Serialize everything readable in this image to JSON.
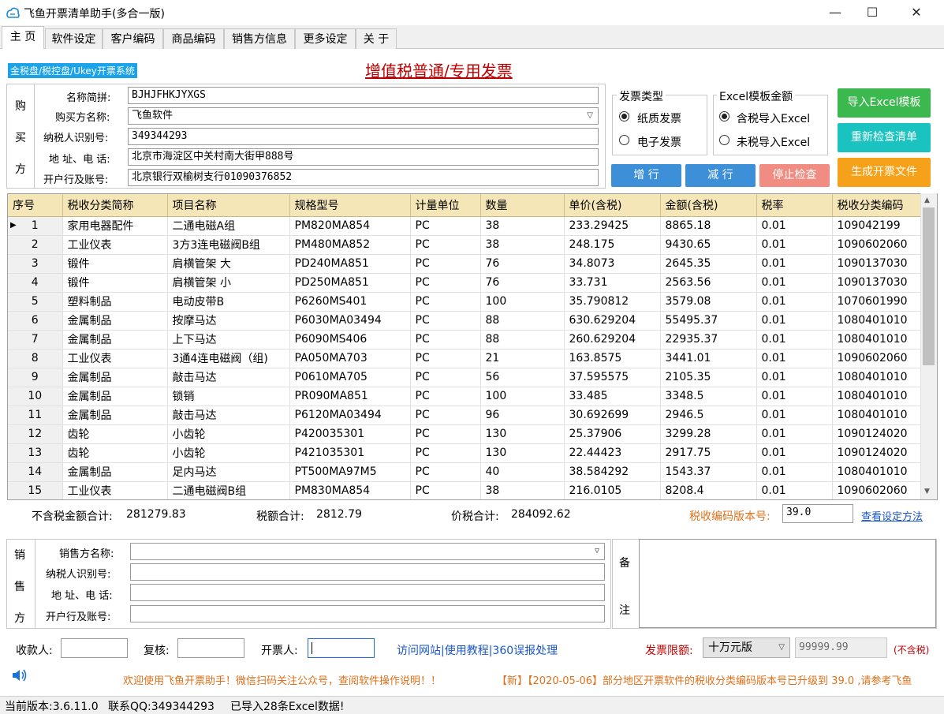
{
  "window": {
    "title": "飞鱼开票清单助手(多合一版)",
    "minimize": "—",
    "maximize": "☐",
    "close": "✕"
  },
  "tabs": [
    "主 页",
    "软件设定",
    "客户编码",
    "商品编码",
    "销售方信息",
    "更多设定",
    "关 于"
  ],
  "mode_badge": "金税盘/税控盘/Ukey开票系统",
  "main_title": "增值税普通/专用发票",
  "buyer": {
    "section_chars": [
      "购",
      "买",
      "方"
    ],
    "labels": [
      "名称简拼:",
      "购买方名称:",
      "纳税人识别号:",
      "地 址、电 话:",
      "开户行及账号:"
    ],
    "name_abbr": "BJHJFHKJYXGS",
    "name": "飞鱼软件",
    "tax_id": "349344293",
    "address_phone": "北京市海淀区中关村南大街甲888号",
    "bank_account": "北京银行双榆树支行01090376852"
  },
  "invoice_type": {
    "title": "发票类型",
    "options": [
      "纸质发票",
      "电子发票"
    ],
    "selected": 0
  },
  "excel_amount": {
    "title": "Excel模板金额",
    "options": [
      "含税导入Excel",
      "未税导入Excel"
    ],
    "selected": 0
  },
  "buttons": {
    "add": "增 行",
    "remove": "减 行",
    "stop": "停止检查",
    "import": "导入Excel模板",
    "recheck": "重新检查清单",
    "generate": "生成开票文件"
  },
  "colors": {
    "green": "#3cb94e",
    "teal": "#1bc3c0",
    "orange": "#f6a11a",
    "blue": "#3d8fd8",
    "salmon": "#f08c82",
    "red_text": "#c00000",
    "orange_text": "#e0701a",
    "link_blue": "#1a56c8"
  },
  "table": {
    "headers": [
      "序号",
      "税收分类简称",
      "项目名称",
      "规格型号",
      "计量单位",
      "数量",
      "单价(含税)",
      "金额(含税)",
      "税率",
      "税收分类编码"
    ],
    "rows": [
      [
        "1",
        "家用电器配件",
        "二通电磁A组",
        "PM820MA854",
        "PC",
        "38",
        "233.29425",
        "8865.18",
        "0.01",
        "109042199"
      ],
      [
        "2",
        "工业仪表",
        "3方3连电磁阀B组",
        "PM480MA852",
        "PC",
        "38",
        "248.175",
        "9430.65",
        "0.01",
        "1090602060"
      ],
      [
        "3",
        "锻件",
        "肩横管架 大",
        "PD240MA851",
        "PC",
        "76",
        "34.8073",
        "2645.35",
        "0.01",
        "1090137030"
      ],
      [
        "4",
        "锻件",
        "肩横管架 小",
        "PD250MA851",
        "PC",
        "76",
        "33.731",
        "2563.56",
        "0.01",
        "1090137030"
      ],
      [
        "5",
        "塑料制品",
        "电动皮带B",
        "P6260MS401",
        "PC",
        "100",
        "35.790812",
        "3579.08",
        "0.01",
        "1070601990"
      ],
      [
        "6",
        "金属制品",
        "按摩马达",
        "P6030MA03494",
        "PC",
        "88",
        "630.629204",
        "55495.37",
        "0.01",
        "1080401010"
      ],
      [
        "7",
        "金属制品",
        "上下马达",
        "P6090MS406",
        "PC",
        "88",
        "260.629204",
        "22935.37",
        "0.01",
        "1080401010"
      ],
      [
        "8",
        "工业仪表",
        "3通4连电磁阀（组)",
        "PA050MA703",
        "PC",
        "21",
        "163.8575",
        "3441.01",
        "0.01",
        "1090602060"
      ],
      [
        "9",
        "金属制品",
        "敲击马达",
        "P0610MA705",
        "PC",
        "56",
        "37.595575",
        "2105.35",
        "0.01",
        "1080401010"
      ],
      [
        "10",
        "金属制品",
        "锁销",
        "PR090MA851",
        "PC",
        "100",
        "33.485",
        "3348.5",
        "0.01",
        "1080401010"
      ],
      [
        "11",
        "金属制品",
        "敲击马达",
        "P6120MA03494",
        "PC",
        "96",
        "30.692699",
        "2946.5",
        "0.01",
        "1080401010"
      ],
      [
        "12",
        "齿轮",
        "小齿轮",
        "P420035301",
        "PC",
        "130",
        "25.37906",
        "3299.28",
        "0.01",
        "1090124020"
      ],
      [
        "13",
        "齿轮",
        "小齿轮",
        "P421035301",
        "PC",
        "130",
        "22.44423",
        "2917.75",
        "0.01",
        "1090124020"
      ],
      [
        "14",
        "金属制品",
        "足内马达",
        "PT500MA97M5",
        "PC",
        "40",
        "38.584292",
        "1543.37",
        "0.01",
        "1080401010"
      ],
      [
        "15",
        "工业仪表",
        "二通电磁阀B组",
        "PM830MA854",
        "PC",
        "38",
        "216.0105",
        "8208.4",
        "0.01",
        "1090602060"
      ]
    ]
  },
  "totals": {
    "pretax_label": "不含税金额合计:",
    "pretax": "281279.83",
    "tax_label": "税额合计:",
    "tax": "2812.79",
    "total_label": "价税合计:",
    "total": "284092.62",
    "code_version_label": "税收编码版本号:",
    "code_version": "39.0",
    "settings_link": "查看设定方法"
  },
  "seller": {
    "section_chars": [
      "销",
      "售",
      "方"
    ],
    "labels": [
      "销售方名称:",
      "纳税人识别号:",
      "地 址、电 话:",
      "开户行及账号:"
    ],
    "remark_chars": [
      "备",
      "注"
    ]
  },
  "signers": {
    "payee_label": "收款人:",
    "reviewer_label": "复核:",
    "drawer_label": "开票人:",
    "links": "访问网站|使用教程|360误报处理",
    "limit_label": "发票限额:",
    "limit_option": "十万元版",
    "limit_value": "99999.99",
    "limit_note": "(不含税)"
  },
  "marquee": {
    "welcome": "欢迎使用飞鱼开票助手！微信扫码关注公众号，查阅软件操作说明！！",
    "news": "【新】【2020-05-06】部分地区开票软件的税收分类编码版本号已升级到 39.0 ,请参考飞鱼"
  },
  "status": {
    "version": "当前版本:3.6.11.0",
    "qq": "联系QQ:349344293",
    "imported": "已导入28条Excel数据!"
  }
}
